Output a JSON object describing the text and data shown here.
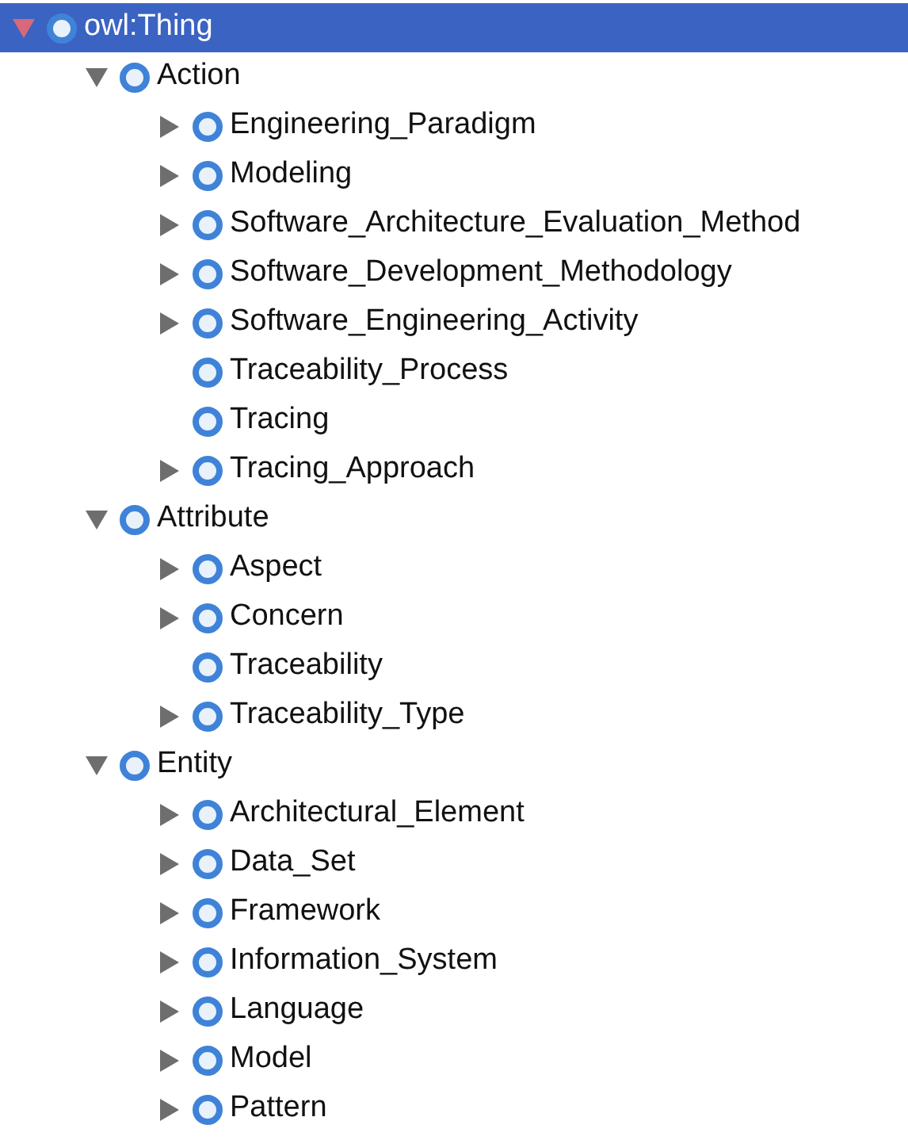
{
  "tree": [
    {
      "label": "owl:Thing",
      "kind": "expanded",
      "selected": true,
      "children": [
        {
          "label": "Action",
          "kind": "expanded",
          "selected": false,
          "children": [
            {
              "label": "Engineering_Paradigm",
              "kind": "collapsed",
              "selected": false
            },
            {
              "label": "Modeling",
              "kind": "collapsed",
              "selected": false
            },
            {
              "label": "Software_Architecture_Evaluation_Method",
              "kind": "collapsed",
              "selected": false
            },
            {
              "label": "Software_Development_Methodology",
              "kind": "collapsed",
              "selected": false
            },
            {
              "label": "Software_Engineering_Activity",
              "kind": "collapsed",
              "selected": false
            },
            {
              "label": "Traceability_Process",
              "kind": "leaf",
              "selected": false
            },
            {
              "label": "Tracing",
              "kind": "leaf",
              "selected": false
            },
            {
              "label": "Tracing_Approach",
              "kind": "collapsed",
              "selected": false
            }
          ]
        },
        {
          "label": "Attribute",
          "kind": "expanded",
          "selected": false,
          "children": [
            {
              "label": "Aspect",
              "kind": "collapsed",
              "selected": false
            },
            {
              "label": "Concern",
              "kind": "collapsed",
              "selected": false
            },
            {
              "label": "Traceability",
              "kind": "leaf",
              "selected": false
            },
            {
              "label": "Traceability_Type",
              "kind": "collapsed",
              "selected": false
            }
          ]
        },
        {
          "label": "Entity",
          "kind": "expanded",
          "selected": false,
          "children": [
            {
              "label": "Architectural_Element",
              "kind": "collapsed",
              "selected": false
            },
            {
              "label": "Data_Set",
              "kind": "collapsed",
              "selected": false
            },
            {
              "label": "Framework",
              "kind": "collapsed",
              "selected": false
            },
            {
              "label": "Information_System",
              "kind": "collapsed",
              "selected": false
            },
            {
              "label": "Language",
              "kind": "collapsed",
              "selected": false
            },
            {
              "label": "Model",
              "kind": "collapsed",
              "selected": false
            },
            {
              "label": "Pattern",
              "kind": "collapsed",
              "selected": false
            }
          ]
        }
      ]
    }
  ]
}
